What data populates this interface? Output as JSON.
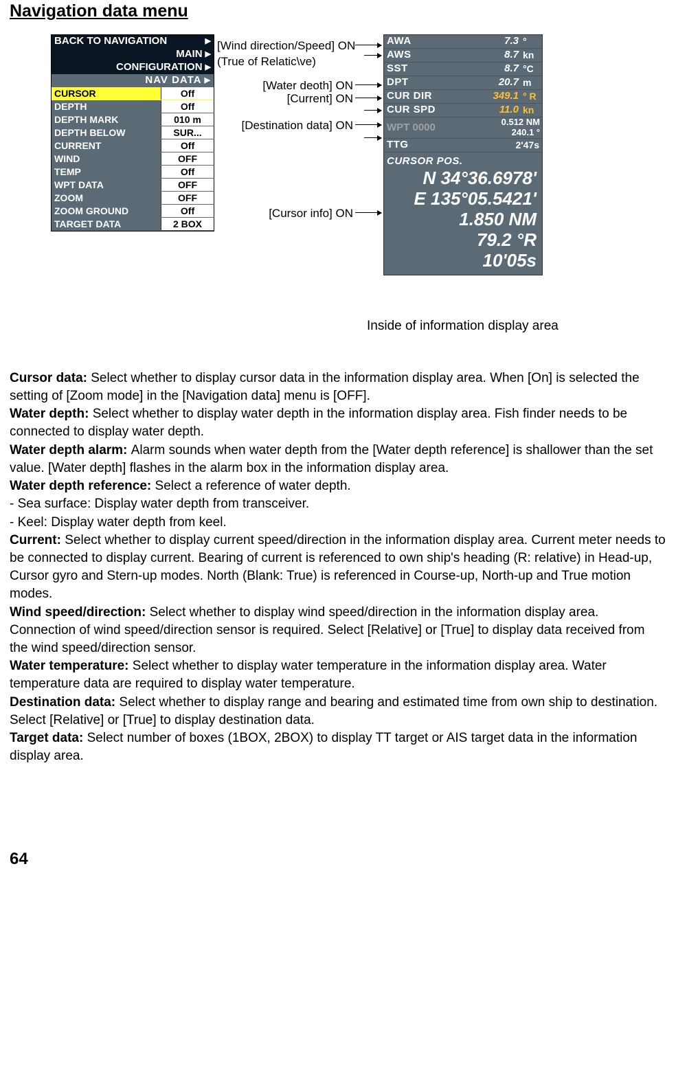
{
  "title": "Navigation data menu",
  "menu": {
    "back": "BACK TO NAVIGATION",
    "main": "MAIN",
    "config": "CONFIGURATION",
    "navdata": "NAV DATA",
    "items": [
      {
        "label": "CURSOR",
        "val": "Off",
        "sel": true
      },
      {
        "label": "DEPTH",
        "val": "Off"
      },
      {
        "label": "DEPTH MARK",
        "val": "010 m"
      },
      {
        "label": "DEPTH BELOW",
        "val": "SUR..."
      },
      {
        "label": "CURRENT",
        "val": "Off"
      },
      {
        "label": "WIND",
        "val": "OFF"
      },
      {
        "label": "TEMP",
        "val": "Off"
      },
      {
        "label": "WPT DATA",
        "val": "OFF"
      },
      {
        "label": "ZOOM",
        "val": "OFF"
      },
      {
        "label": "ZOOM GROUND",
        "val": "Off"
      },
      {
        "label": "TARGET DATA",
        "val": "2 BOX"
      }
    ]
  },
  "annot": {
    "wind1": "[Wind direction/Speed] ON",
    "wind2": "(True of Relatic\\ve)",
    "water": "[Water deoth] ON",
    "current": "[Current] ON",
    "dest": "[Destination data] ON",
    "cursor": "[Cursor info] ON"
  },
  "info": {
    "rows": [
      {
        "lab": "AWA",
        "val": "7.3",
        "unit": "°"
      },
      {
        "lab": "AWS",
        "val": "8.7",
        "unit": "kn"
      },
      {
        "lab": "SST",
        "val": "8.7",
        "unit": "°C"
      },
      {
        "lab": "DPT",
        "val": "20.7",
        "unit": "m"
      },
      {
        "lab": "CUR DIR",
        "val": "349.1",
        "unit": "° R",
        "hl": true
      },
      {
        "lab": "CUR SPD",
        "val": "11.0",
        "unit": "kn",
        "hl": true
      }
    ],
    "wpt_lab": "WPT 0000",
    "wpt_val1": "0.512 NM",
    "wpt_val2": "240.1 °",
    "ttg_lab": "TTG",
    "ttg_val": "2'47s",
    "cursor_h": "CURSOR POS.",
    "lat": "N 34°36.6978'",
    "lon": "E 135°05.5421'",
    "dist": "1.850 NM",
    "brg": "79.2 °R",
    "ttg2": "10'05s"
  },
  "caption": "Inside of information display area",
  "body": {
    "p1b": "Cursor data: ",
    "p1": "Select whether to display cursor data in the information display area. When [On] is selected the setting of [Zoom mode] in the [Navigation data] menu is [OFF].",
    "p2b": "Water depth: ",
    "p2": "Select whether to display water depth in the information display area. Fish finder needs to be connected to display water depth.",
    "p3b": "Water depth alarm: ",
    "p3": "Alarm sounds when water depth from the [Water depth reference] is shallower than the set value. [Water depth] flashes in the alarm box in the information display area.",
    "p4b": "Water depth reference: ",
    "p4": "Select a reference of water depth.",
    "p4a": "- Sea surface: Display water depth from transceiver.",
    "p4c": "- Keel: Display water depth from keel.",
    "p5b": "Current: ",
    "p5": "Select whether to display current speed/direction in the information display area. Current meter needs to be connected to display current. Bearing of current is referenced to own ship's heading (R: relative) in Head-up, Cursor gyro and Stern-up modes. North (Blank: True) is referenced in Course-up, North-up and True motion modes.",
    "p6b": "Wind speed/direction: ",
    "p6": "Select whether to display wind speed/direction in the information display area. Connection of wind speed/direction sensor is required. Select [Relative] or [True] to display data received from the wind speed/direction sensor.",
    "p7b": "Water temperature: ",
    "p7": "Select whether to display water temperature in the information display area. Water temperature data are required to display water temperature.",
    "p8b": "Destination data: ",
    "p8": "Select whether to display range and bearing and estimated time from own ship to destination. Select [Relative] or [True] to display destination data.",
    "p9b": "Target data: ",
    "p9": "Select number of boxes (1BOX, 2BOX) to display TT target or AIS target data in the information display area."
  },
  "pagenum": "64"
}
